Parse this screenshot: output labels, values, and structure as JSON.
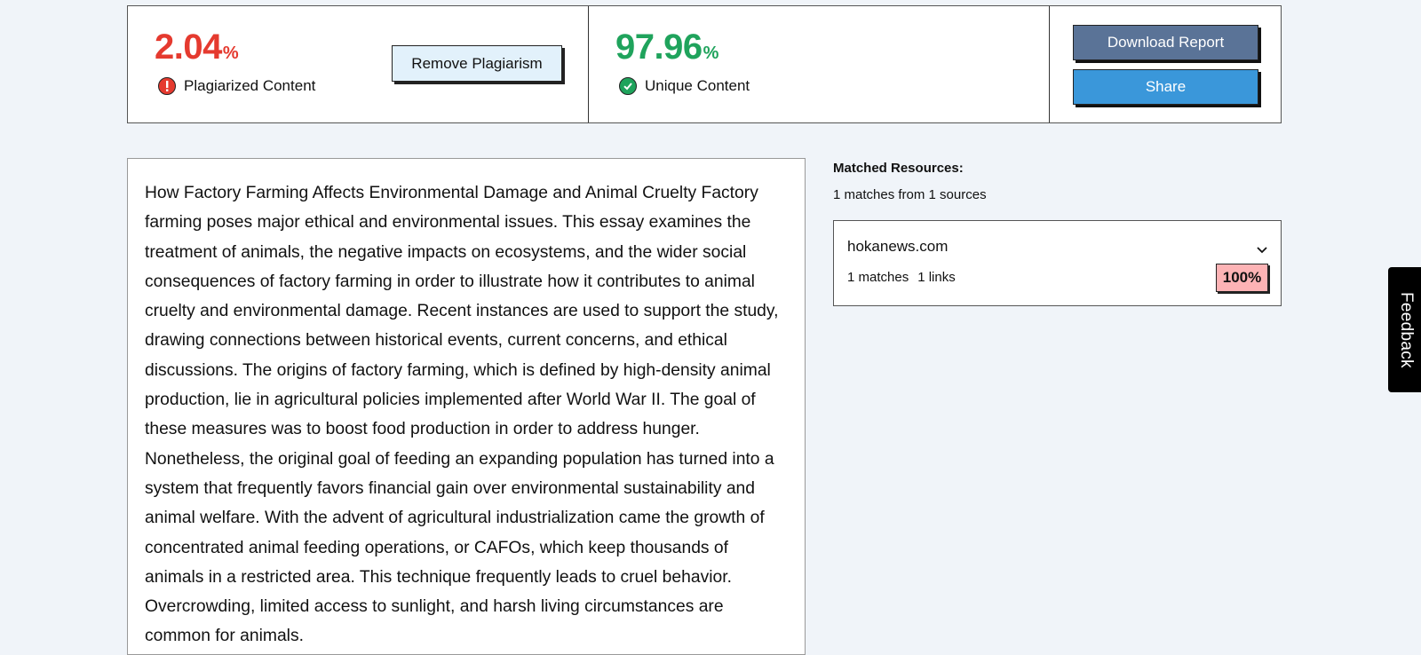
{
  "summary": {
    "plagiarized": {
      "value": "2.04",
      "unit": "%",
      "label": "Plagiarized Content"
    },
    "unique": {
      "value": "97.96",
      "unit": "%",
      "label": "Unique Content"
    },
    "remove_button": "Remove Plagiarism",
    "download_button": "Download Report",
    "share_button": "Share"
  },
  "document": {
    "text": "How Factory Farming Affects Environmental Damage and Animal Cruelty Factory farming poses major ethical and environmental issues. This essay examines the treatment of animals, the negative impacts on ecosystems, and the wider social consequences of factory farming in order to illustrate how it contributes to animal cruelty and environmental damage. Recent instances are used to support the study, drawing connections between historical events, current concerns, and ethical discussions. The origins of factory farming, which is defined by high-density animal production, lie in agricultural policies implemented after World War II. The goal of these measures was to boost food production in order to address hunger. Nonetheless, the original goal of feeding an expanding population has turned into a system that frequently favors financial gain over environmental sustainability and animal welfare. With the advent of agricultural industrialization came the growth of concentrated animal feeding operations, or CAFOs, which keep thousands of animals in a restricted area. This technique frequently leads to cruel behavior. Overcrowding, limited access to sunlight, and harsh living circumstances are common for animals."
  },
  "matches": {
    "title": "Matched Resources:",
    "summary": "1 matches from 1 sources",
    "sources": [
      {
        "domain": "hokanews.com",
        "matches": "1 matches",
        "links": "1 links",
        "percent": "100%"
      }
    ]
  },
  "feedback": {
    "label": "Feedback"
  },
  "colors": {
    "plagiarized": "#e53a2f",
    "unique": "#1fa35c",
    "download_bg": "#5a7397",
    "share_bg": "#3a97da",
    "badge_bg": "#fdb3b5",
    "page_bg": "#f0f4f9"
  },
  "icons": {
    "plagiarized": "exclamation-circle-icon",
    "unique": "check-circle-icon",
    "expand": "chevron-down-icon"
  }
}
